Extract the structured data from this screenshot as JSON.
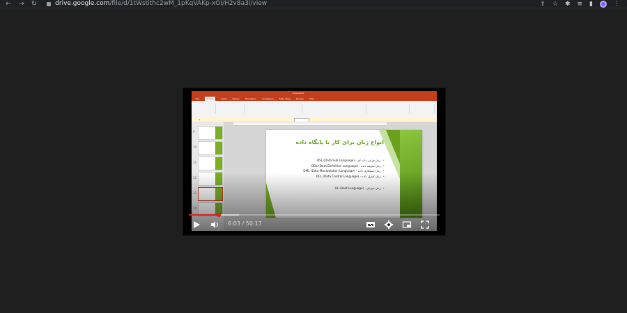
{
  "browser": {
    "back_icon": "←",
    "forward_icon": "→",
    "reload_icon": "↻",
    "url_domain": "drive.google.com",
    "url_path": "/file/d/1tWstithc2wM_1pKqVAKp-xOI/H2v8a3i/view"
  },
  "video": {
    "time_display": "6:03 / 50:17",
    "progress_fraction": 0.12,
    "buffer_fraction": 0.2,
    "accent_color": "#e11d1d"
  },
  "slide": {
    "title": "انواع زبان برای کار با پایگاه داده",
    "bullets": [
      "زبان فرعی داده ای - DSL (Data Sub Language)",
      "زبان تعریف داده - DDL (Data Definition Language)",
      "زبان دستکاری داده - DML (Data Manipulation Language)",
      "زبان کنترل داده - DCL (Data Control Language)",
      "زبان میزبان - HL (Host Language)"
    ],
    "theme_color": "#6aa11e"
  },
  "powerpoint": {
    "tabs": [
      "File",
      "Home",
      "Insert",
      "Design",
      "Transitions",
      "Animations",
      "Slide Show",
      "Review",
      "View"
    ],
    "active_tab": "Home"
  }
}
